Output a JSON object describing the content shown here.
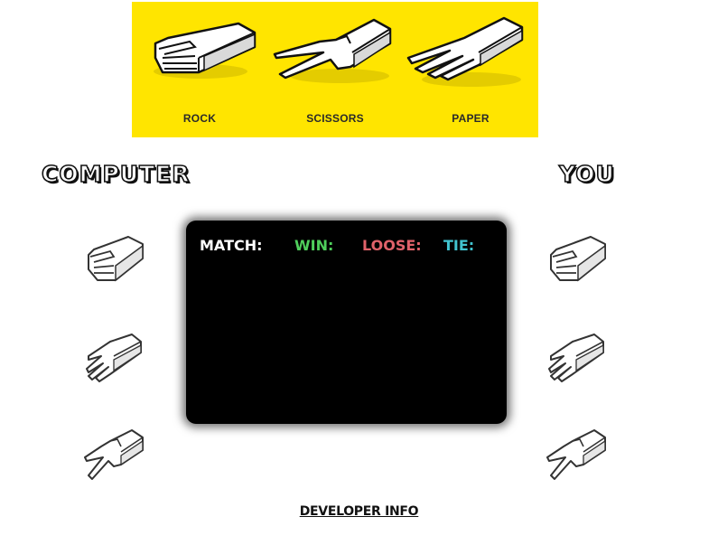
{
  "banner": {
    "background_color": "#ffe500",
    "items": [
      {
        "label": "ROCK",
        "icon": "rock-hand-icon"
      },
      {
        "label": "SCISSORS",
        "icon": "scissors-hand-icon"
      },
      {
        "label": "PAPER",
        "icon": "paper-hand-icon"
      }
    ]
  },
  "computer": {
    "title": "COMPUTER",
    "choices": [
      "rock-hand-icon",
      "paper-hand-icon",
      "scissors-hand-icon"
    ]
  },
  "player": {
    "title": "YOU",
    "choices": [
      "rock-hand-icon",
      "paper-hand-icon",
      "scissors-hand-icon"
    ]
  },
  "scoreboard": {
    "match_label": "MATCH:",
    "win_label": "WIN:",
    "loose_label": "LOOSE:",
    "tie_label": "TIE:",
    "colors": {
      "match": "#ffffff",
      "win": "#4fce5b",
      "loose": "#e0626a",
      "tie": "#41c3cf"
    }
  },
  "footer": {
    "developer_link": "DEVELOPER INFO"
  }
}
